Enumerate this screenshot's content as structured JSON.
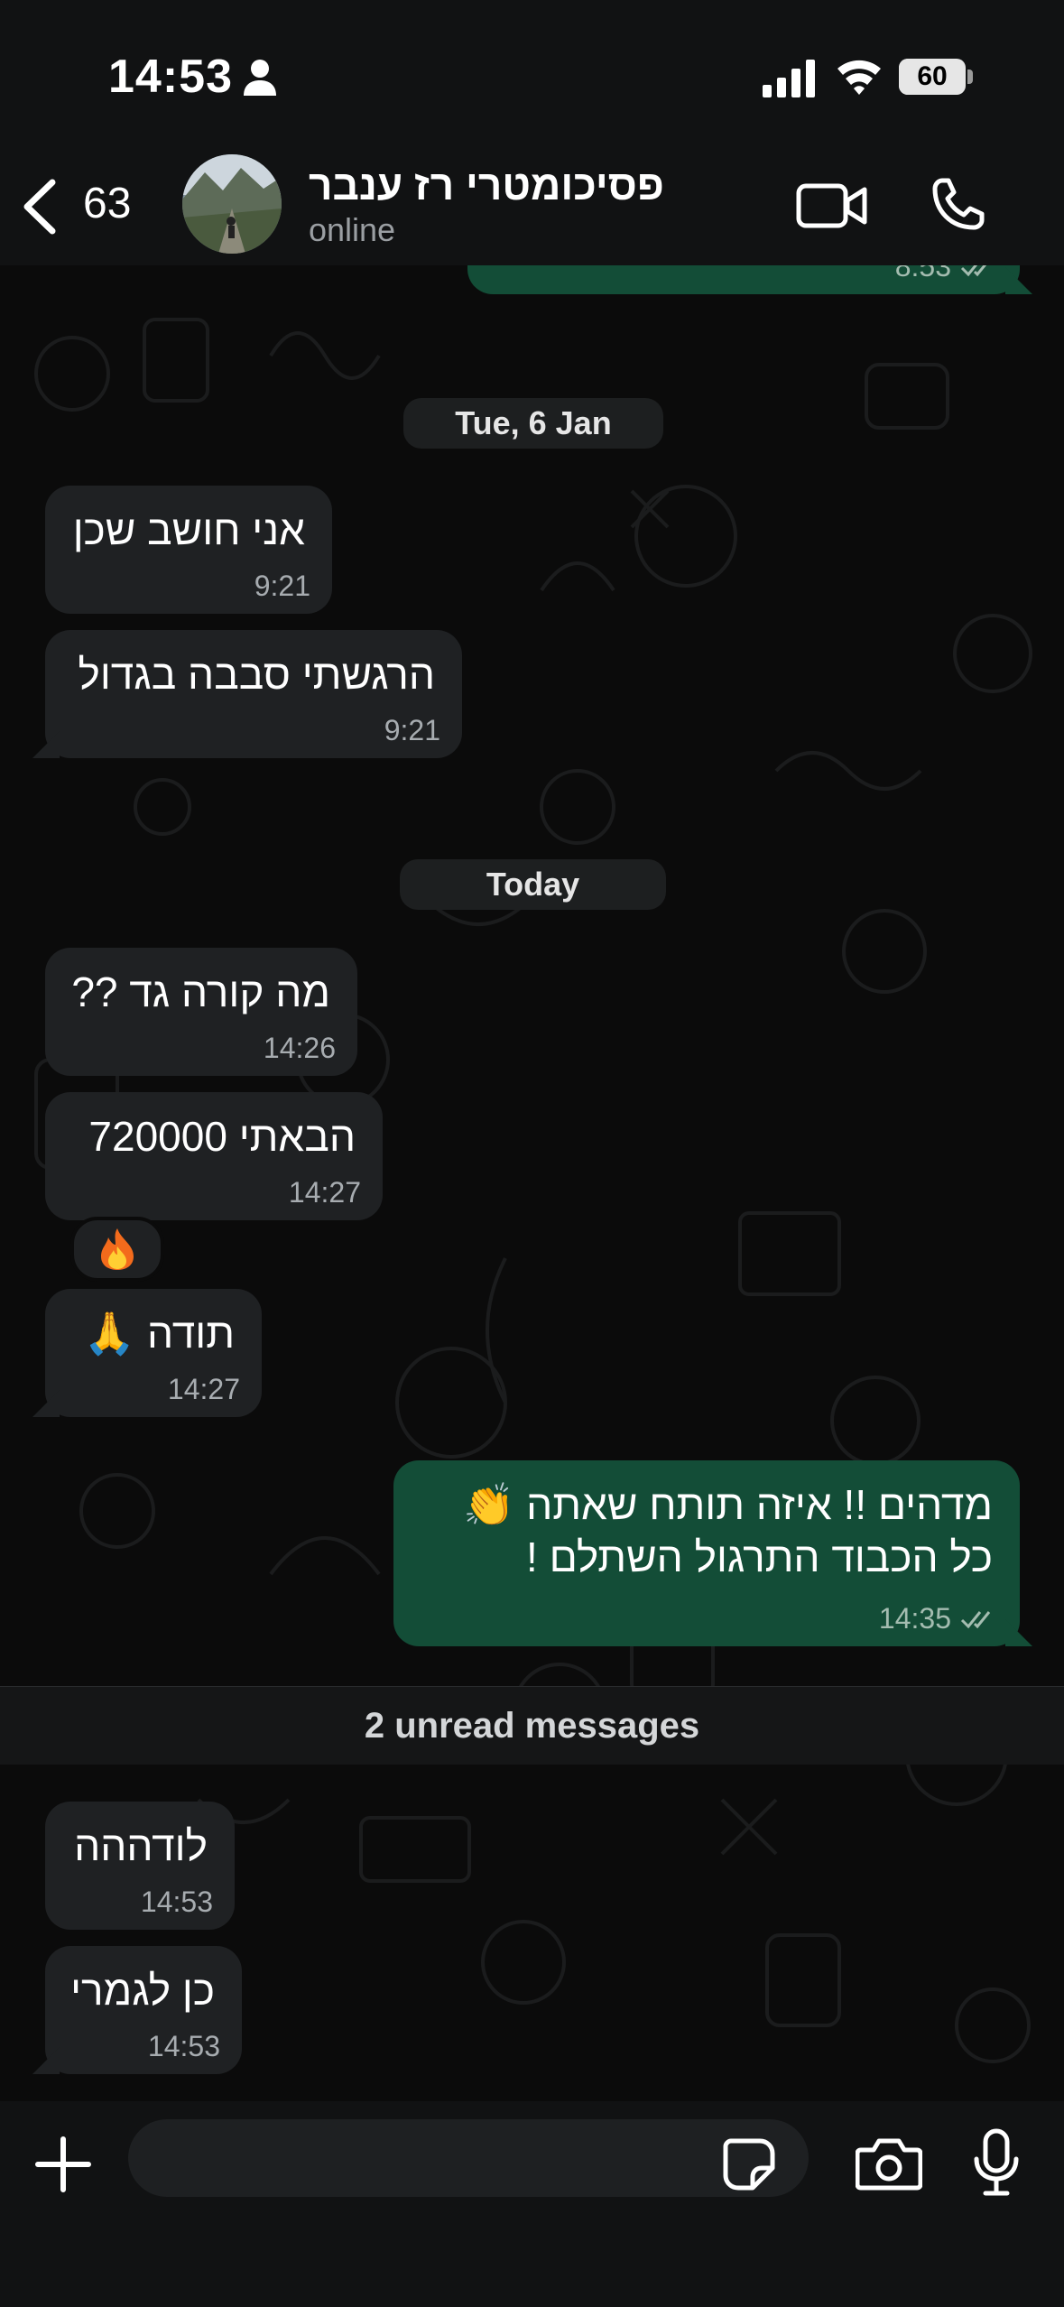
{
  "status_bar": {
    "time": "14:53",
    "battery": "60",
    "battery_level": 0.6
  },
  "header": {
    "back_count": "63",
    "contact_name": "פסיכומטרי רז ענבר",
    "contact_status": "online"
  },
  "chat": {
    "partial_message_time": "8:53",
    "date_1": "Tue, 6 Jan",
    "date_2": "Today",
    "messages": [
      {
        "text": "אני חושב שכן",
        "time": "9:21",
        "direction": "incoming"
      },
      {
        "text": "הרגשתי סבבה בגדול",
        "time": "9:21",
        "direction": "incoming"
      },
      {
        "text": "מה קורה גד ??",
        "time": "14:26",
        "direction": "incoming"
      },
      {
        "text": "הבאתי 720000",
        "time": "14:27",
        "direction": "incoming"
      },
      {
        "text": "תודה 🙏",
        "time": "14:27",
        "direction": "incoming"
      },
      {
        "text_line_1": "מדהים !! איזה תותח שאתה 👏",
        "text_line_2": "כל הכבוד התרגול השתלם !",
        "time": "14:35",
        "direction": "outgoing"
      },
      {
        "text": "לודההה",
        "time": "14:53",
        "direction": "incoming"
      },
      {
        "text": "כן לגמרי",
        "time": "14:53",
        "direction": "incoming"
      }
    ],
    "reaction_emoji": "🔥",
    "unread_divider": "2 unread messages"
  },
  "input": {
    "placeholder": ""
  },
  "colors": {
    "outgoing_bubble": "#134d37",
    "incoming_bubble": "#1f2123",
    "read_tick": "#a4bcb0"
  }
}
